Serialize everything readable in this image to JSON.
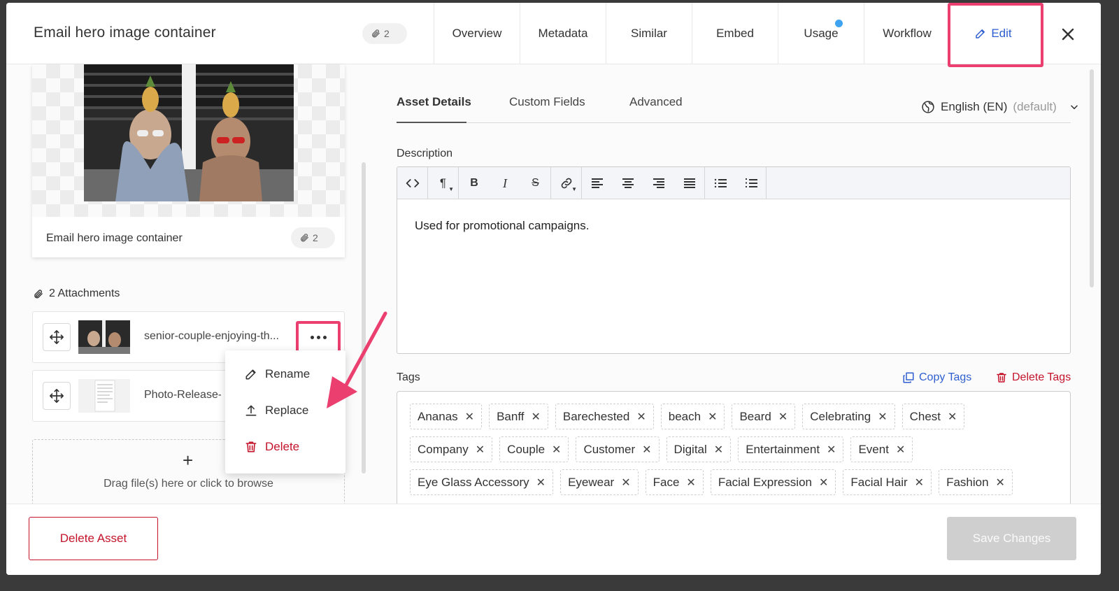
{
  "asset": {
    "title": "Email hero image container",
    "attachment_count": "2"
  },
  "nav": {
    "tabs": [
      {
        "label": "Overview"
      },
      {
        "label": "Metadata"
      },
      {
        "label": "Similar"
      },
      {
        "label": "Embed"
      },
      {
        "label": "Usage"
      },
      {
        "label": "Workflow"
      },
      {
        "label": "Edit"
      }
    ]
  },
  "preview": {
    "caption": "Email hero image container",
    "count": "2"
  },
  "attachments": {
    "header": "2 Attachments",
    "items": [
      {
        "name": "senior-couple-enjoying-th..."
      },
      {
        "name": "Photo-Release-"
      }
    ],
    "dropzone_text": "Drag file(s) here or click to browse"
  },
  "menu": {
    "rename": "Rename",
    "replace": "Replace",
    "delete": "Delete"
  },
  "details": {
    "tabs": [
      "Asset Details",
      "Custom Fields",
      "Advanced"
    ],
    "language": "English (EN)",
    "language_note": "(default)",
    "description_label": "Description",
    "description": "Used for promotional campaigns."
  },
  "tags": {
    "label": "Tags",
    "copy": "Copy Tags",
    "delete": "Delete Tags",
    "items": [
      "Ananas",
      "Banff",
      "Barechested",
      "beach",
      "Beard",
      "Celebrating",
      "Chest",
      "Company",
      "Couple",
      "Customer",
      "Digital",
      "Entertainment",
      "Event",
      "Eye Glass Accessory",
      "Eyewear",
      "Face",
      "Facial Expression",
      "Facial Hair",
      "Fashion"
    ]
  },
  "footer": {
    "delete_asset": "Delete Asset",
    "save": "Save Changes"
  },
  "colors": {
    "accent": "#2f5fd0",
    "danger": "#c4142c",
    "highlight": "#ea3f6f",
    "usage_dot": "#3ea3f0"
  }
}
